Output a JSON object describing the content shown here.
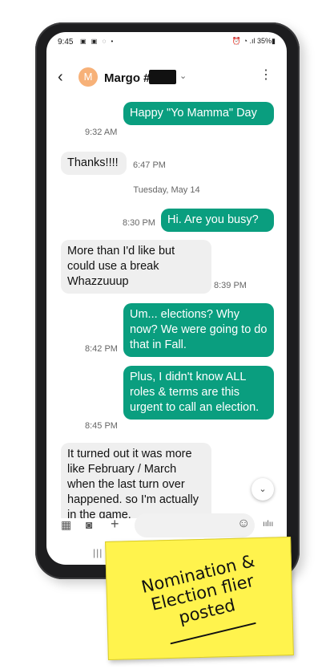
{
  "status_bar": {
    "time": "9:45",
    "left_icons": "▣ ▣ ◌ •",
    "right_icons": "⏰ ◔ .ıl 35%▮"
  },
  "header": {
    "back": "‹",
    "avatar_letter": "M",
    "contact_name": "Margo #",
    "chevron": "⌄",
    "more": "⋮"
  },
  "messages": [
    {
      "dir": "out",
      "text": "Happy \"Yo Mamma\" Day",
      "time": "9:32 AM"
    },
    {
      "dir": "in",
      "text": "Thanks!!!!",
      "time": "6:47 PM"
    },
    {
      "date_separator": "Tuesday, May 14"
    },
    {
      "dir": "out",
      "text": "Hi. Are you busy?",
      "time": "8:30 PM"
    },
    {
      "dir": "in",
      "text": "More than I'd like but could use a break Whazzuuup",
      "time": "8:39 PM"
    },
    {
      "dir": "out",
      "text": "Um... elections? Why now? We were going to do that in Fall.",
      "time": "8:42 PM"
    },
    {
      "dir": "out",
      "text": "Plus, I didn't know ALL roles & terms are this urgent to call an election.",
      "time": "8:45 PM"
    },
    {
      "dir": "in",
      "text": "It turned out it was more like February / March when the last turn over happened. so I'm actually in the game.",
      "time": ""
    }
  ],
  "composer": {
    "placeholder": "",
    "gallery_icon": "▦",
    "camera_icon": "◙",
    "plus_icon": "+",
    "emoji_icon": "☺",
    "voice_icon": "ıılıı"
  },
  "scroll_down_icon": "⌄",
  "nav": {
    "recents": "|||"
  },
  "sticky_note": {
    "text": "Nomination & Election flier posted"
  }
}
